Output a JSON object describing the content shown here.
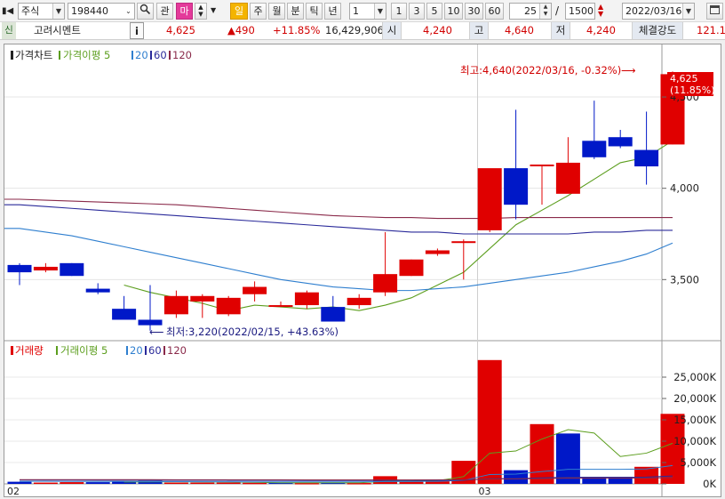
{
  "toolbar": {
    "market_select": "주식",
    "code_value": "198440",
    "btn_watch": "관",
    "btn_ma": "마",
    "periods": [
      "일",
      "주",
      "월",
      "분",
      "틱",
      "년"
    ],
    "minute_select": "1",
    "minute_buttons": [
      "1",
      "3",
      "5",
      "10",
      "30",
      "60"
    ],
    "zoom_value": "25",
    "zoom_sep": "/",
    "zoom_total": "1500",
    "date_value": "2022/03/16"
  },
  "quote": {
    "badge": "신",
    "name": "고려시멘트",
    "info_btn": "i",
    "price": "4,625",
    "change": "▲490",
    "change_pct": "+11.85%",
    "volume": "16,429,906",
    "open_label": "시",
    "open": "4,240",
    "high_label": "고",
    "high": "4,640",
    "low_label": "저",
    "low": "4,240",
    "strength_label": "체결강도",
    "strength": "121.1"
  },
  "colors": {
    "up": "#e00000",
    "down": "#0018c8",
    "ma5": "#5c9e1e",
    "ma20": "#2f7fcf",
    "ma60": "#2a2a9a",
    "ma120": "#8a2a4a"
  },
  "legend_price": {
    "main": "가격차트",
    "ma": "가격이평 5",
    "p20": "20",
    "p60": "60",
    "p120": "120"
  },
  "legend_volume": {
    "main": "거래량",
    "ma": "거래이평 5",
    "p20": "20",
    "p60": "60",
    "p120": "120"
  },
  "annotations": {
    "max_text": "최고:4,640(2022/03/16, -0.32%)",
    "min_text": "최저:3,220(2022/02/15, +43.63%)",
    "last_price": "4,625",
    "last_pct": "(11.85%)"
  },
  "chart_data": [
    {
      "type": "candlestick",
      "x": [
        "02/03",
        "02/04",
        "02/07",
        "02/08",
        "02/09",
        "02/10",
        "02/11",
        "02/14",
        "02/15",
        "02/16",
        "02/17",
        "02/18",
        "02/21",
        "02/22",
        "02/23",
        "02/24",
        "02/25",
        "02/28",
        "03/02",
        "03/03",
        "03/04",
        "03/07",
        "03/08",
        "03/10",
        "03/11",
        "03/14",
        "03/15",
        "03/16"
      ],
      "series": [
        {
          "name": "가격차트",
          "ohlc": [
            [
              3580,
              3590,
              3470,
              3540
            ],
            [
              3550,
              3590,
              3540,
              3570
            ],
            [
              3590,
              3590,
              3520,
              3520
            ],
            [
              3450,
              3480,
              3420,
              3430
            ],
            [
              3340,
              3410,
              3310,
              3280
            ],
            [
              3280,
              3470,
              3220,
              3250
            ],
            [
              3310,
              3440,
              3290,
              3410
            ],
            [
              3380,
              3420,
              3290,
              3410
            ],
            [
              3310,
              3410,
              3300,
              3400
            ],
            [
              3420,
              3490,
              3380,
              3460
            ],
            [
              3360,
              3380,
              3350,
              3360
            ],
            [
              3360,
              3440,
              3340,
              3430
            ],
            [
              3350,
              3410,
              3290,
              3270
            ],
            [
              3360,
              3420,
              3340,
              3400
            ],
            [
              3430,
              3760,
              3410,
              3530
            ],
            [
              3520,
              3610,
              3520,
              3610
            ],
            [
              3640,
              3670,
              3630,
              3660
            ],
            [
              3710,
              3720,
              3500,
              3710
            ],
            [
              3770,
              4050,
              3760,
              4110
            ],
            [
              4110,
              4430,
              3830,
              3910
            ],
            [
              4130,
              4130,
              3910,
              4130
            ],
            [
              3970,
              4280,
              3990,
              4140
            ],
            [
              4260,
              4480,
              4160,
              4170
            ],
            [
              4280,
              4320,
              4220,
              4230
            ],
            [
              4210,
              4420,
              4020,
              4120
            ],
            [
              4240,
              4640,
              4240,
              4625
            ]
          ]
        }
      ],
      "ma": [
        {
          "name": "5",
          "values": [
            null,
            null,
            null,
            null,
            3470,
            3430,
            3400,
            3370,
            3330,
            3360,
            3350,
            3340,
            3350,
            3330,
            3360,
            3400,
            3470,
            3540,
            3670,
            3800,
            3880,
            3960,
            4050,
            4140,
            4170,
            4260
          ]
        },
        {
          "name": "20",
          "values": [
            3780,
            3760,
            3740,
            3710,
            3680,
            3650,
            3620,
            3590,
            3560,
            3530,
            3500,
            3480,
            3460,
            3450,
            3440,
            3440,
            3450,
            3460,
            3480,
            3500,
            3520,
            3540,
            3570,
            3600,
            3640,
            3700
          ]
        },
        {
          "name": "60",
          "values": [
            3910,
            3900,
            3890,
            3880,
            3870,
            3860,
            3850,
            3840,
            3830,
            3820,
            3810,
            3800,
            3790,
            3780,
            3770,
            3760,
            3760,
            3750,
            3750,
            3750,
            3750,
            3750,
            3760,
            3760,
            3770,
            3770
          ]
        },
        {
          "name": "120",
          "values": [
            3940,
            3935,
            3930,
            3925,
            3920,
            3915,
            3910,
            3900,
            3890,
            3880,
            3870,
            3860,
            3850,
            3845,
            3840,
            3840,
            3835,
            3835,
            3835,
            3840,
            3840,
            3840,
            3840,
            3840,
            3840,
            3840
          ]
        }
      ],
      "ylim": [
        3180,
        4700
      ],
      "y_ticks": [
        "3,500",
        "4,000",
        "4,500"
      ],
      "x_ticks": [
        "02",
        "03"
      ]
    },
    {
      "type": "bar",
      "series": [
        {
          "name": "거래량",
          "values": [
            500,
            300,
            400,
            400,
            600,
            700,
            300,
            300,
            300,
            250,
            300,
            200,
            300,
            200,
            1800,
            500,
            600,
            5400,
            29000,
            3200,
            14000,
            11800,
            1500,
            1600,
            4000,
            16400
          ],
          "up": [
            false,
            true,
            true,
            false,
            false,
            false,
            true,
            true,
            true,
            true,
            false,
            true,
            false,
            true,
            true,
            true,
            true,
            true,
            true,
            false,
            true,
            false,
            false,
            false,
            true,
            true
          ]
        }
      ],
      "ma": [
        {
          "name": "5",
          "values": [
            null,
            null,
            null,
            null,
            440,
            480,
            500,
            460,
            440,
            370,
            270,
            270,
            270,
            250,
            570,
            600,
            720,
            1700,
            7200,
            7700,
            10500,
            12700,
            11900,
            6400,
            7200,
            9500
          ]
        },
        {
          "name": "20",
          "values": [
            600,
            590,
            580,
            570,
            560,
            540,
            520,
            500,
            500,
            480,
            480,
            470,
            460,
            460,
            540,
            560,
            590,
            820,
            2200,
            2300,
            2900,
            3400,
            3400,
            3400,
            3500,
            4300
          ]
        },
        {
          "name": "60",
          "values": [
            900,
            890,
            880,
            870,
            860,
            850,
            840,
            830,
            820,
            810,
            800,
            790,
            780,
            780,
            800,
            800,
            810,
            850,
            1200,
            1250,
            1400,
            1550,
            1550,
            1550,
            1600,
            1850
          ]
        },
        {
          "name": "120",
          "values": [
            1000,
            1000,
            995,
            990,
            985,
            980,
            975,
            970,
            965,
            960,
            955,
            950,
            945,
            945,
            950,
            950,
            955,
            975,
            1150,
            1175,
            1250,
            1330,
            1330,
            1330,
            1350,
            1480
          ]
        }
      ],
      "ylim": [
        0,
        30000
      ],
      "y_ticks": [
        "0K",
        "5,000K",
        "10,000K",
        "15,000K",
        "20,000K",
        "25,000K"
      ]
    }
  ]
}
